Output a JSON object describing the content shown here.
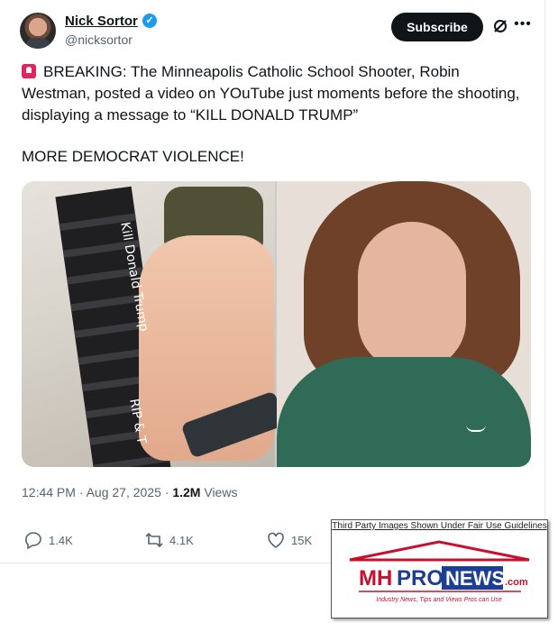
{
  "tweet": {
    "author_name": "Nick Sortor",
    "author_handle": "@nicksortor",
    "subscribe_label": "Subscribe",
    "text_line1": "BREAKING: The Minneapolis Catholic School Shooter, Robin Westman, posted a video on YOuTube just moments before the shooting, displaying a message to “KILL DONALD TRUMP”",
    "text_line2": "MORE DEMOCRAT VIOLENCE!",
    "image_left_writing": "Kill Donald Trump",
    "image_left_writing2": "RIP & T",
    "meta_time": "12:44 PM · Aug 27, 2025 · ",
    "meta_views_count": "1.2M",
    "meta_views_label": " Views",
    "replies": "1.4K",
    "reposts": "4.1K",
    "likes": "15K",
    "icons": [
      "verified-badge-icon",
      "grok-icon",
      "more-icon",
      "reply-icon",
      "repost-icon",
      "like-icon",
      "siren-emoji-icon"
    ]
  },
  "watermark": {
    "caption": "Third Party Images Shown Under Fair Use Guidelines",
    "logo_mh": "MH",
    "logo_pro": "PRO",
    "logo_news": "NEWS",
    "logo_com": ".com",
    "tagline": "Industry News, Tips and Views Pros can Use",
    "colors": {
      "red": "#c8102e",
      "blue": "#1c3f94"
    }
  }
}
